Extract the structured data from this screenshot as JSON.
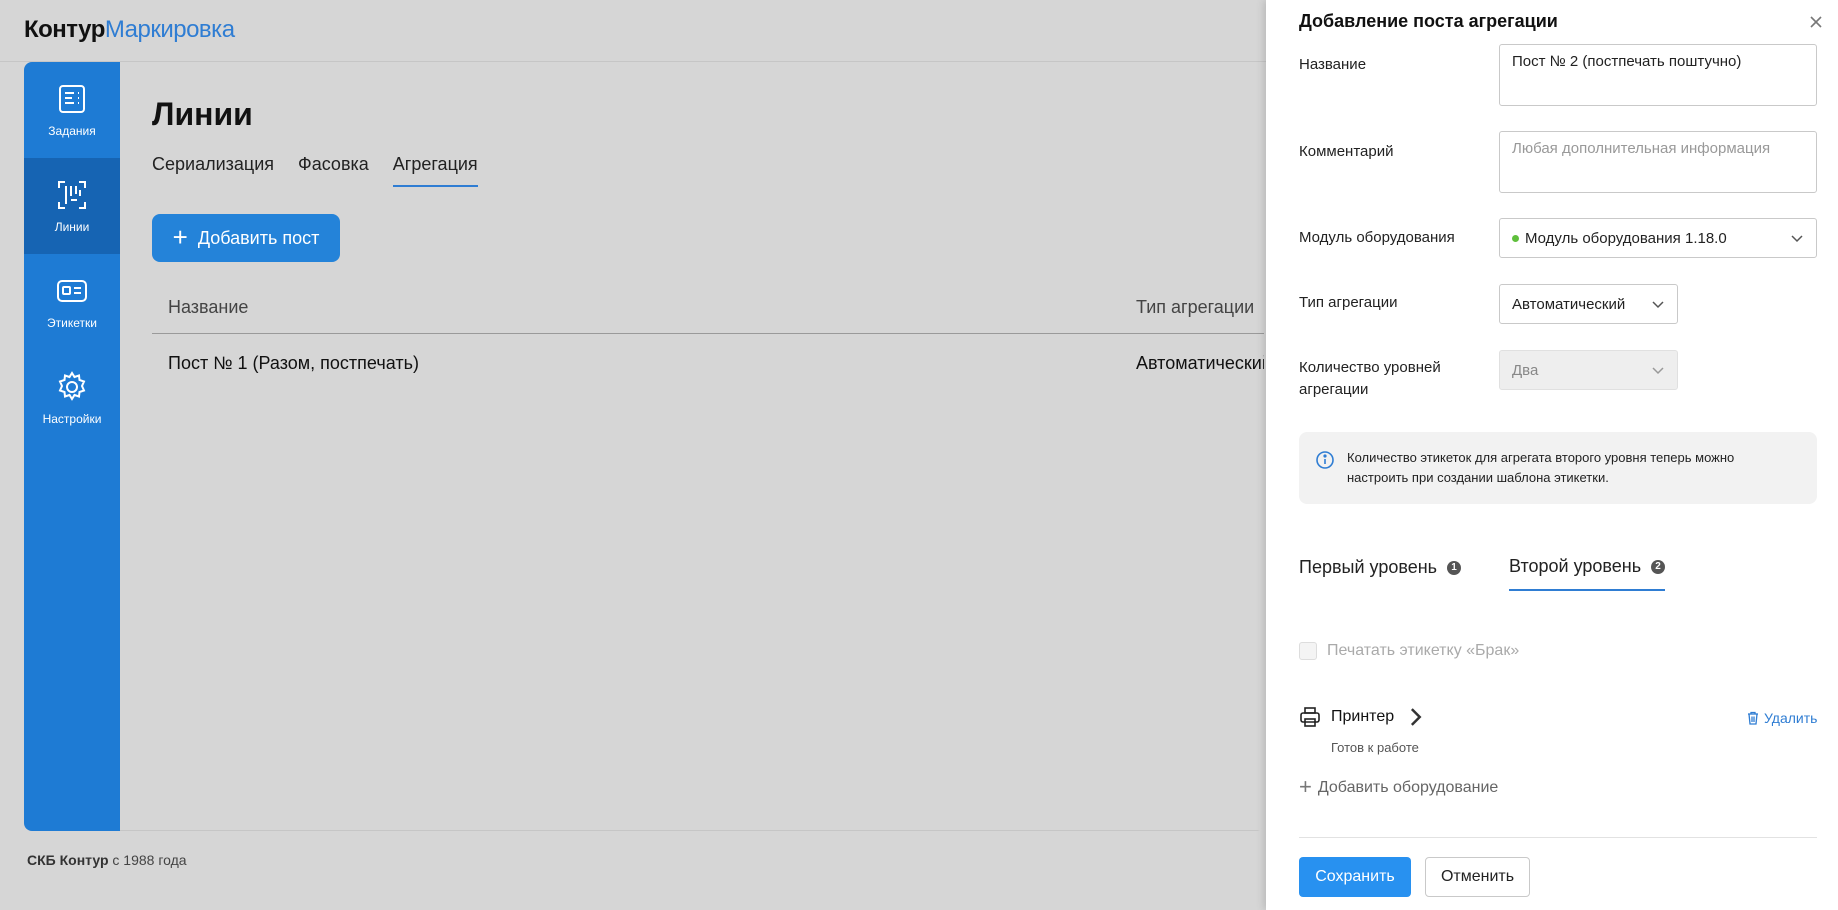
{
  "header": {
    "brand": "Контур",
    "product": "Маркировка"
  },
  "sidebar": {
    "items": [
      {
        "label": "Задания",
        "icon": "tasks-icon"
      },
      {
        "label": "Линии",
        "icon": "lines-icon",
        "active": true
      },
      {
        "label": "Этикетки",
        "icon": "label-icon"
      },
      {
        "label": "Настройки",
        "icon": "gear-icon"
      }
    ]
  },
  "main": {
    "title": "Линии",
    "tabs": [
      {
        "label": "Сериализация"
      },
      {
        "label": "Фасовка"
      },
      {
        "label": "Агрегация",
        "active": true
      }
    ],
    "add_button": "Добавить пост",
    "table": {
      "columns": [
        "Название",
        "Тип агрегации"
      ],
      "rows": [
        [
          "Пост № 1 (Разом, постпечать)",
          "Автоматический"
        ]
      ]
    }
  },
  "footer": {
    "company": "СКБ Контур",
    "since": "с 1988 года"
  },
  "panel": {
    "title": "Добавление поста агрегации",
    "name_label": "Название",
    "name_value": "Пост № 2 (постпечать поштучно)",
    "comment_label": "Комментарий",
    "comment_placeholder": "Любая дополнительная информация",
    "module_label": "Модуль оборудования",
    "module_value": "Модуль оборудования 1.18.0",
    "module_status_color": "#5fbf3c",
    "agg_type_label": "Тип агрегации",
    "agg_type_value": "Автоматический",
    "levels_label": "Количество уровней агрегации",
    "levels_value": "Два",
    "info_text": "Количество этикеток для агрегата второго уровня теперь можно настроить при создании шаблона этикетки.",
    "level_tabs": [
      {
        "label": "Первый уровень",
        "badge": "1"
      },
      {
        "label": "Второй уровень",
        "badge": "2",
        "active": true
      }
    ],
    "print_defect_label": "Печатать этикетку «Брак»",
    "printer_label": "Принтер",
    "printer_status": "Готов к работе",
    "delete_label": "Удалить",
    "add_equipment_label": "Добавить оборудование",
    "save_label": "Сохранить",
    "cancel_label": "Отменить"
  },
  "colors": {
    "accent": "#2f7dd3",
    "sidebar": "#1e7bd4",
    "save": "#2891f0"
  }
}
